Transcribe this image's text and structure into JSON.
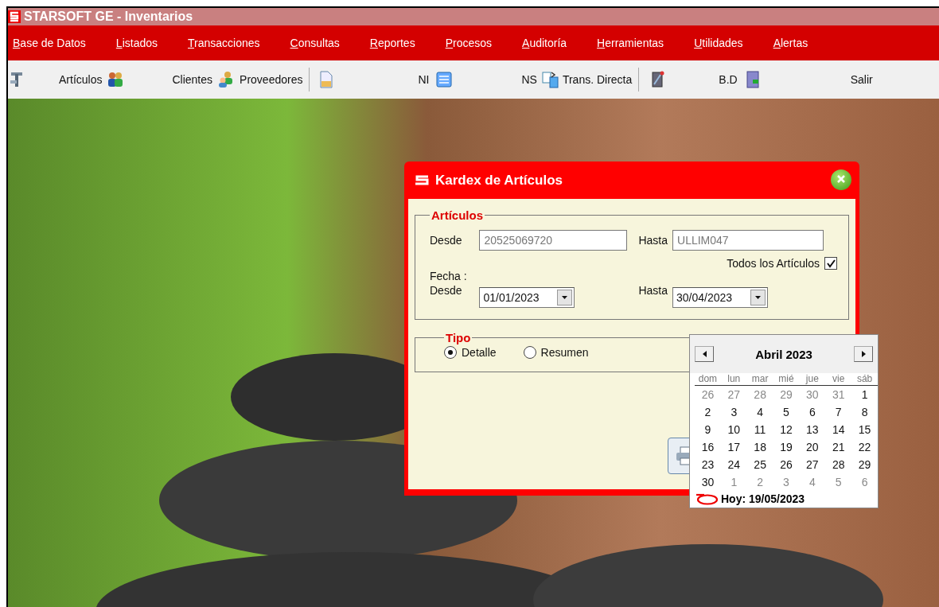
{
  "window": {
    "title": "STARSOFT GE - Inventarios"
  },
  "menu": [
    "Base de Datos",
    "Listados",
    "Transacciones",
    "Consultas",
    "Reportes",
    "Procesos",
    "Auditoría",
    "Herramientas",
    "Utilidades",
    "Alertas"
  ],
  "toolbar": [
    "Artículos",
    "Clientes",
    "Proveedores",
    "NI",
    "NS",
    "Trans. Directa",
    "B.D",
    "Salir"
  ],
  "dialog": {
    "title": "Kardex de Artículos",
    "articulos": {
      "legend": "Artículos",
      "desde_label": "Desde",
      "desde_value": "20525069720",
      "hasta_label": "Hasta",
      "hasta_value": "ULLIM047",
      "todos_label": "Todos los Artículos",
      "todos_checked": true,
      "fecha_label": "Fecha :",
      "fecha_desde_label": "Desde",
      "fecha_desde": "01/01/2023",
      "fecha_hasta_label": "Hasta",
      "fecha_hasta": "30/04/2023"
    },
    "tipo": {
      "legend": "Tipo",
      "options": [
        {
          "label": "Detalle",
          "selected": true
        },
        {
          "label": "Resumen",
          "selected": false
        }
      ]
    }
  },
  "calendar": {
    "month": "Abril 2023",
    "weekdays": [
      "dom",
      "lun",
      "mar",
      "mié",
      "jue",
      "vie",
      "sáb"
    ],
    "weeks": [
      [
        {
          "day": "26",
          "in_month": false
        },
        {
          "day": "27",
          "in_month": false
        },
        {
          "day": "28",
          "in_month": false
        },
        {
          "day": "29",
          "in_month": false
        },
        {
          "day": "30",
          "in_month": false
        },
        {
          "day": "31",
          "in_month": false
        },
        {
          "day": "1",
          "in_month": true
        }
      ],
      [
        {
          "day": "2",
          "in_month": true
        },
        {
          "day": "3",
          "in_month": true
        },
        {
          "day": "4",
          "in_month": true
        },
        {
          "day": "5",
          "in_month": true
        },
        {
          "day": "6",
          "in_month": true
        },
        {
          "day": "7",
          "in_month": true
        },
        {
          "day": "8",
          "in_month": true
        }
      ],
      [
        {
          "day": "9",
          "in_month": true
        },
        {
          "day": "10",
          "in_month": true
        },
        {
          "day": "11",
          "in_month": true
        },
        {
          "day": "12",
          "in_month": true
        },
        {
          "day": "13",
          "in_month": true
        },
        {
          "day": "14",
          "in_month": true
        },
        {
          "day": "15",
          "in_month": true
        }
      ],
      [
        {
          "day": "16",
          "in_month": true
        },
        {
          "day": "17",
          "in_month": true
        },
        {
          "day": "18",
          "in_month": true
        },
        {
          "day": "19",
          "in_month": true
        },
        {
          "day": "20",
          "in_month": true
        },
        {
          "day": "21",
          "in_month": true
        },
        {
          "day": "22",
          "in_month": true
        }
      ],
      [
        {
          "day": "23",
          "in_month": true
        },
        {
          "day": "24",
          "in_month": true
        },
        {
          "day": "25",
          "in_month": true
        },
        {
          "day": "26",
          "in_month": true
        },
        {
          "day": "27",
          "in_month": true
        },
        {
          "day": "28",
          "in_month": true
        },
        {
          "day": "29",
          "in_month": true
        }
      ],
      [
        {
          "day": "30",
          "in_month": true
        },
        {
          "day": "1",
          "in_month": false
        },
        {
          "day": "2",
          "in_month": false
        },
        {
          "day": "3",
          "in_month": false
        },
        {
          "day": "4",
          "in_month": false
        },
        {
          "day": "5",
          "in_month": false
        },
        {
          "day": "6",
          "in_month": false
        }
      ]
    ],
    "today": "Hoy: 19/05/2023"
  }
}
